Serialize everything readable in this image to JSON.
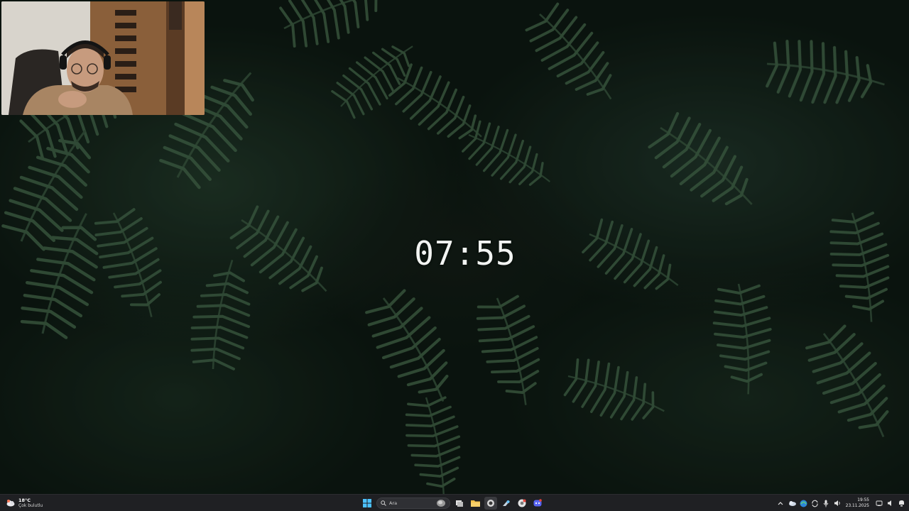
{
  "desktop": {
    "clock_text": "07:55"
  },
  "taskbar": {
    "weather": {
      "temperature": "18°C",
      "description": "Çok bulutlu",
      "icon": "cloudy-weather-icon"
    },
    "search": {
      "placeholder": "Ara"
    },
    "apps": [
      {
        "name": "start-button",
        "icon": "windows-logo-icon",
        "color": "#4cc2ff"
      },
      {
        "name": "task-view-button",
        "icon": "task-view-icon"
      },
      {
        "name": "file-explorer-button",
        "icon": "folder-icon",
        "color": "#f3c14b"
      },
      {
        "name": "obs-button",
        "icon": "record-icon",
        "active": true
      },
      {
        "name": "steam-button",
        "icon": "steam-icon"
      },
      {
        "name": "chrome-button",
        "icon": "chrome-icon"
      },
      {
        "name": "discord-button",
        "icon": "discord-icon",
        "color": "#5865f2"
      }
    ],
    "tray": {
      "icons": [
        "chevron-up-icon",
        "onedrive-icon",
        "edge-icon",
        "sync-icon",
        "microphone-icon",
        "volume-icon",
        "network-icon",
        "speaker-icon"
      ],
      "time": "19:55",
      "date": "23.11.2025"
    }
  }
}
